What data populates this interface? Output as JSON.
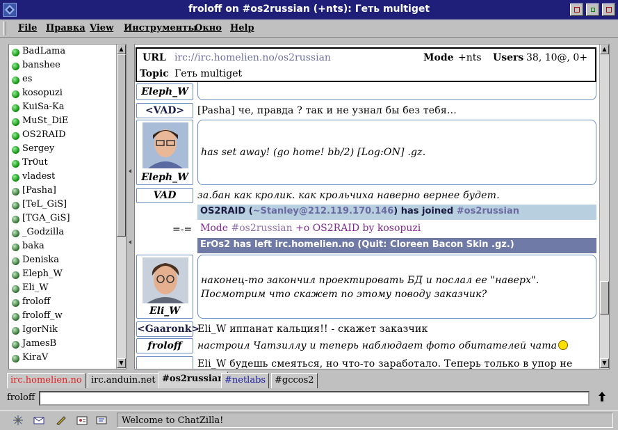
{
  "window": {
    "title": "froloff on #os2russian (+nts): Гeть multiget"
  },
  "menu": [
    "File",
    "Правка",
    "View",
    "Инструменты",
    "Окно",
    "Help"
  ],
  "nicklist": [
    {
      "nick": "BadLama",
      "voice": false
    },
    {
      "nick": "banshee",
      "voice": false
    },
    {
      "nick": "es",
      "voice": false
    },
    {
      "nick": "kosopuzi",
      "voice": false
    },
    {
      "nick": "KuiSa-Ka",
      "voice": false
    },
    {
      "nick": "MuSt_DiE",
      "voice": false
    },
    {
      "nick": "OS2RAID",
      "voice": false
    },
    {
      "nick": "Sergey",
      "voice": false
    },
    {
      "nick": "Tr0ut",
      "voice": false
    },
    {
      "nick": "vladest",
      "voice": false
    },
    {
      "nick": "[Pasha]",
      "voice": true
    },
    {
      "nick": "[TeL_GiS]",
      "voice": true
    },
    {
      "nick": "[TGA_GiS]",
      "voice": true
    },
    {
      "nick": "_Godzilla",
      "voice": true
    },
    {
      "nick": "baka",
      "voice": true
    },
    {
      "nick": "Deniska",
      "voice": true
    },
    {
      "nick": "Eleph_W",
      "voice": true
    },
    {
      "nick": "Eli_W",
      "voice": true
    },
    {
      "nick": "froloff",
      "voice": true
    },
    {
      "nick": "froloff_w",
      "voice": true
    },
    {
      "nick": "IgorNik",
      "voice": true
    },
    {
      "nick": "JamesB",
      "voice": true
    },
    {
      "nick": "KiraV",
      "voice": true
    }
  ],
  "header": {
    "url_label": "URL",
    "url": "irc://irc.homelien.no/os2russian",
    "mode_label": "Mode",
    "mode": "+nts",
    "users_label": "Users",
    "users": "38, 10@, 0+",
    "topic_label": "Topic",
    "topic": "Гeть multiget"
  },
  "messages": {
    "m1_nick": "Eleph_W",
    "m2_nick": "<VAD>",
    "m2_text": "[Pasha] че, правда ? так и не узнал бы без тебя...",
    "m3_nick": "Eleph_W",
    "m3_text": "has set away! (go home! bb/2) [Log:ON] .gz.",
    "m4_nick": "VAD",
    "m4_text": "за.бан как кролик. как крольчиха наверно вернее будет.",
    "sys_marker": "=-=",
    "join_nick": "OS2RAID",
    "join_host": "~Stanley@212.119.170.146",
    "join_text": "has joined",
    "join_chan": "#os2russian",
    "mode_pre": "Mode",
    "mode_chan": "#os2russian",
    "mode_post": "+o OS2RAID by kosopuzi",
    "part_text": "ErOs2 has left irc.homelien.no (Quit: Cloreen Bacon Skin .gz.)",
    "m5_nick": "Eli_W",
    "m5_text": "наконец-то закончил проектировать БД и послал ее \"наверх\". Посмотрим что скажет по этому поводу заказчик?",
    "m6_nick": "<Gaaronk>",
    "m6_text": "Eli_W иппанат кальция!! - скажет заказчик",
    "m7_nick": "froloff",
    "m7_text": "настроил Чатзиллу и теперь наблюдает фото обитателей чата",
    "m8_text": "Eli_W будешь смеяться, но что-то заработало. Теперь только в упор не"
  },
  "tabs": [
    "irc.homelien.no",
    "irc.anduin.net",
    "#os2russian",
    "#netlabs",
    "#gccos2"
  ],
  "input": {
    "nick": "froloff",
    "value": ""
  },
  "status": {
    "text": "Welcome to ChatZilla!"
  },
  "colors": {
    "disconnected_tab": "#e02020",
    "activity_tab": "#2020a0",
    "join_bg": "#b8cfe0",
    "part_bg": "#707aa6",
    "mode_fg": "#802a90"
  }
}
